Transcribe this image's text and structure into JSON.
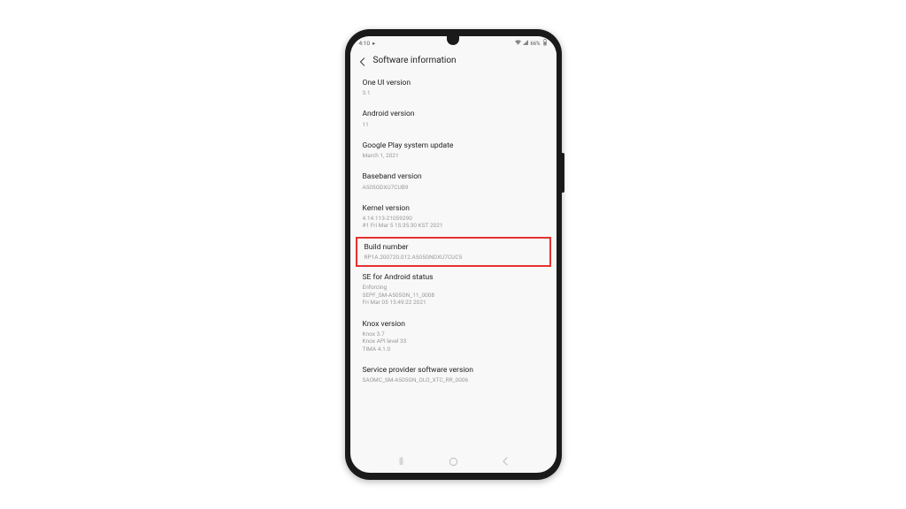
{
  "status_bar": {
    "time": "4:10",
    "battery_text": "66%"
  },
  "header": {
    "title": "Software information"
  },
  "items": [
    {
      "title": "One UI version",
      "subtitle": "3.1",
      "highlight": false
    },
    {
      "title": "Android version",
      "subtitle": "11",
      "highlight": false
    },
    {
      "title": "Google Play system update",
      "subtitle": "March 1, 2021",
      "highlight": false
    },
    {
      "title": "Baseband version",
      "subtitle": "A505GDXU7CUB9",
      "highlight": false
    },
    {
      "title": "Kernel version",
      "subtitle": "4.14.113-21059290\n#1 Fri Mar 5 15:35:30 KST 2021",
      "highlight": false
    },
    {
      "title": "Build number",
      "subtitle": "RP1A.200720.012.A505GNDXU7CUC5",
      "highlight": true
    },
    {
      "title": "SE for Android status",
      "subtitle": "Enforcing\nSEPF_SM-A505GN_11_0008\nFri Mar 05 15:49:22 2021",
      "highlight": false
    },
    {
      "title": "Knox version",
      "subtitle": "Knox 3.7\nKnox API level 33\nTIMA 4.1.0",
      "highlight": false
    },
    {
      "title": "Service provider software version",
      "subtitle": "SAOMC_SM-A505GN_OLO_XTC_RR_0006",
      "highlight": false
    }
  ]
}
